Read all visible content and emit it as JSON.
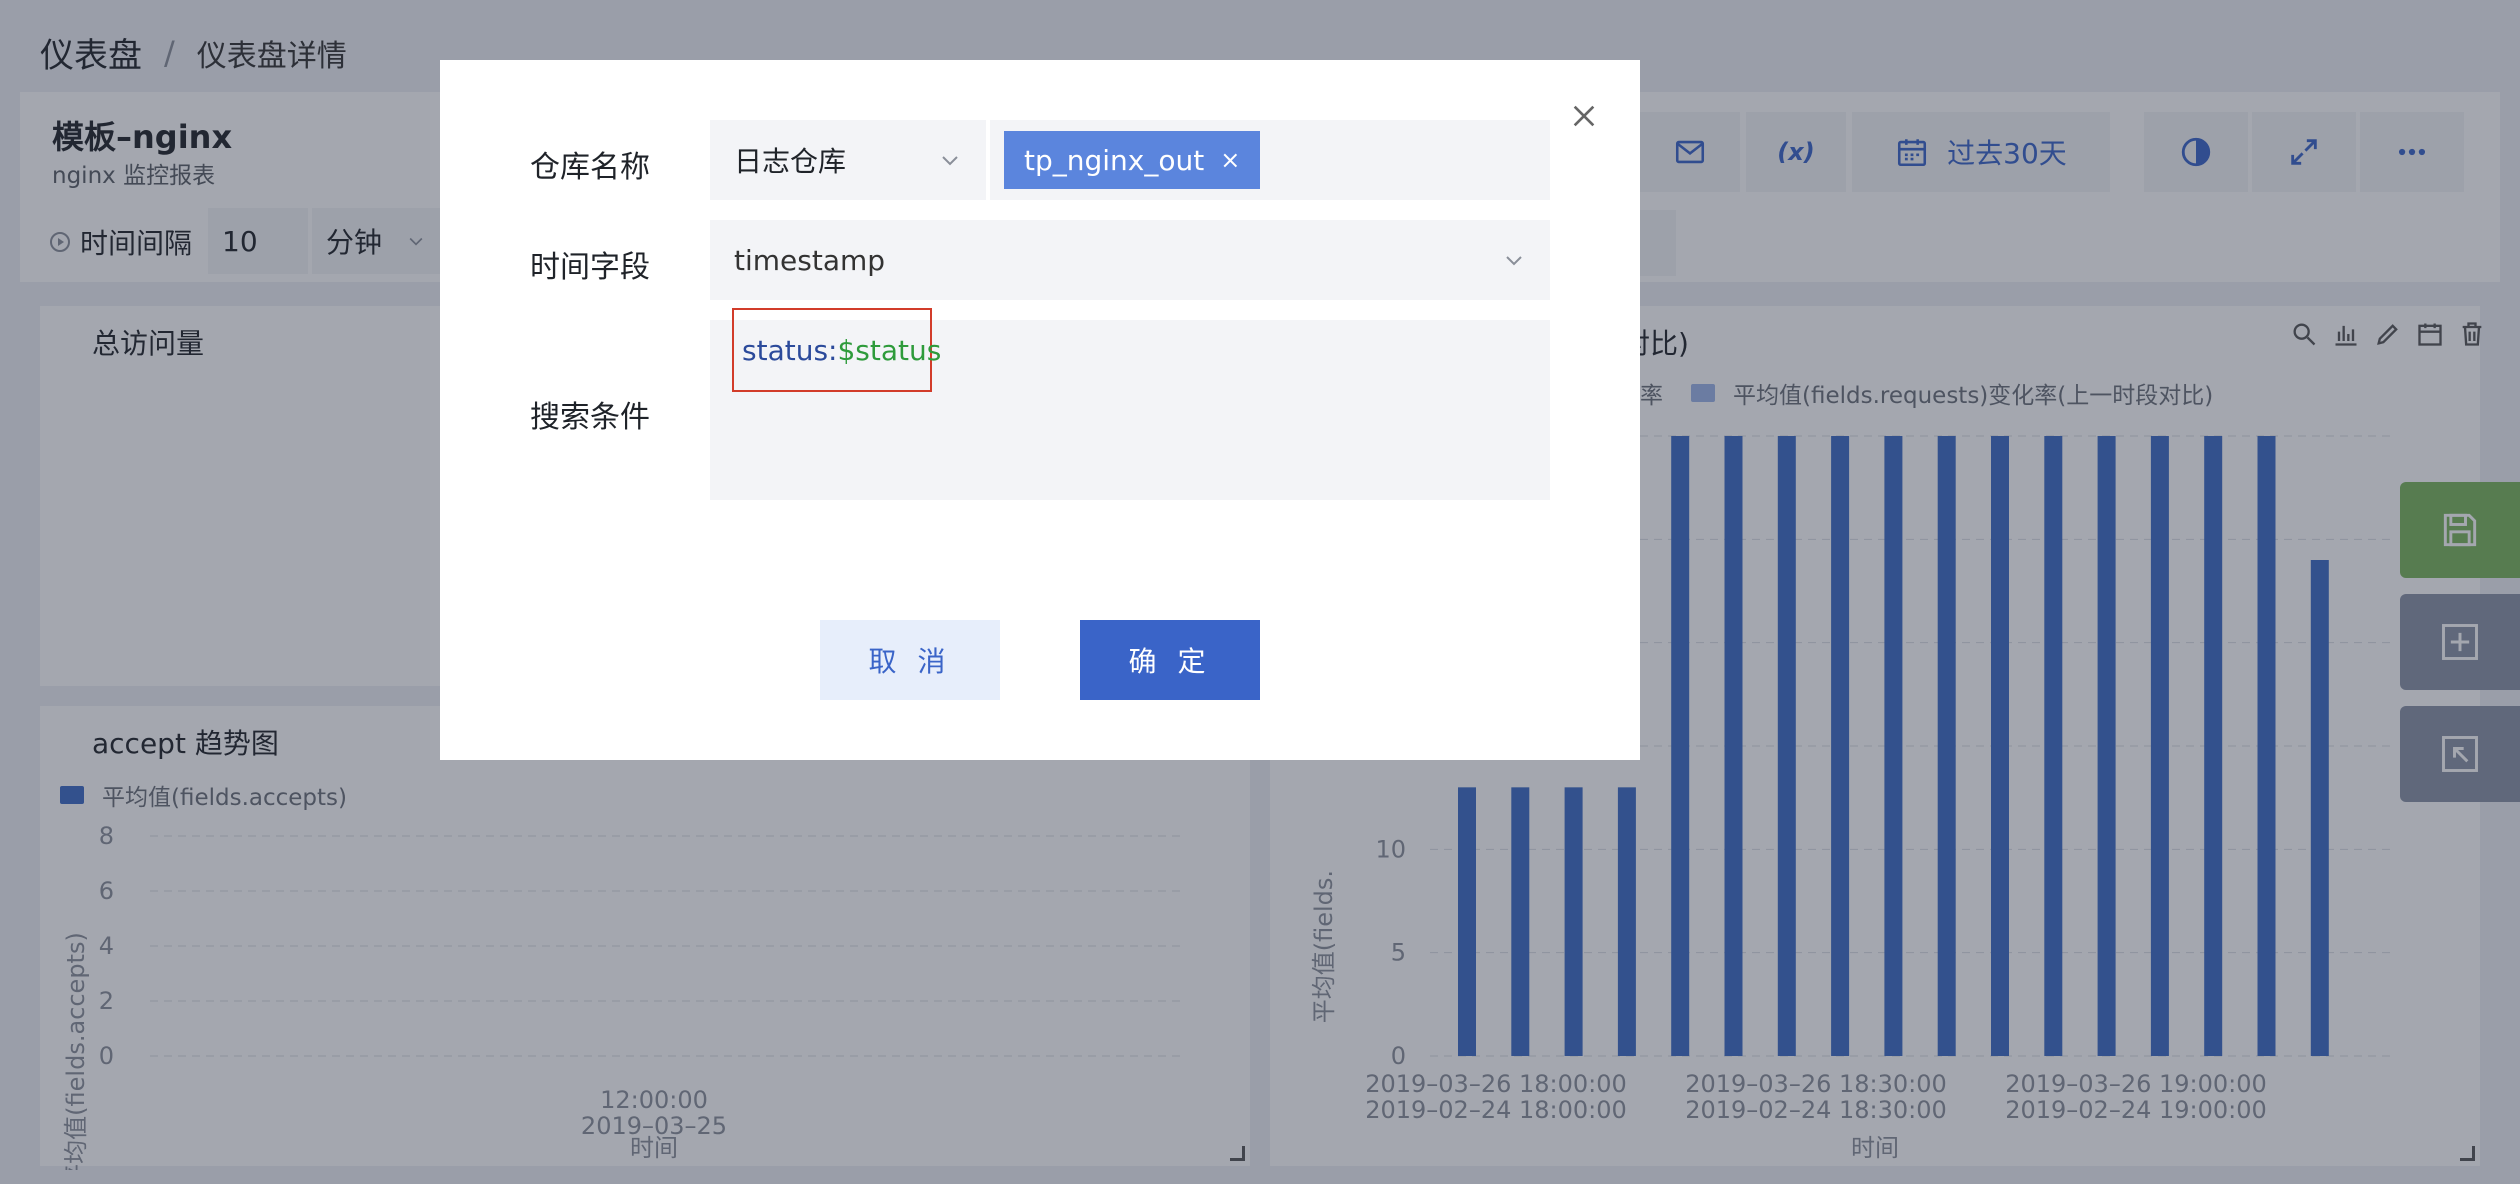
{
  "breadcrumb": {
    "root": "仪表盘",
    "separator": "/",
    "current": "仪表盘详情"
  },
  "dashboard": {
    "title": "模板–nginx",
    "subtitle": "nginx 监控报表",
    "time_range": "过去30天",
    "refresh": {
      "label": "时间间隔",
      "value": "10",
      "unit": "分钟"
    }
  },
  "panels": {
    "total_visits": {
      "title": "总访问量"
    },
    "right_chart": {
      "title_fragment": "段对比)"
    },
    "accept": {
      "title": "accept 趋势图"
    }
  },
  "chart_data": [
    {
      "type": "line",
      "title": "accept 趋势图",
      "series": [
        {
          "name": "平均值(fields.accepts)",
          "values": []
        }
      ],
      "ylabel": "平均值(fields.accepts)",
      "xlabel": "时间",
      "y_ticks": [
        "0",
        "2",
        "4",
        "6",
        "8"
      ],
      "x_ticks": [
        {
          "line1": "12:00:00",
          "line2": "2019–03–25"
        }
      ],
      "legend": "top-left",
      "grid": true
    },
    {
      "type": "bar",
      "title": "段对比)",
      "legend_items": [
        "率",
        "平均值(fields.requests)变化率(上一时段对比)"
      ],
      "ylabel": "平均值(fields.",
      "xlabel": "时间",
      "y_ticks": [
        "0",
        "5",
        "10"
      ],
      "x_ticks": [
        {
          "line1": "2019–03–26 18:00:00",
          "line2": "2019–02–24 18:00:00"
        },
        {
          "line1": "2019–03–26 18:30:00",
          "line2": "2019–02–24 18:30:00"
        },
        {
          "line1": "2019–03–26 19:00:00",
          "line2": "2019–02–24 19:00:00"
        }
      ],
      "ylim": [
        0,
        30
      ],
      "bar_color": "#3d6bc4",
      "values": [
        13,
        13,
        13,
        13,
        30,
        30,
        30,
        30,
        30,
        30,
        30,
        30,
        30,
        30,
        30,
        30,
        24
      ],
      "grid": true
    }
  ],
  "modal": {
    "repo_label": "仓库名称",
    "repo_select": "日志仓库",
    "repo_tag": "tp_nginx_out",
    "time_field_label": "时间字段",
    "time_field_value": "timestamp",
    "search_label": "搜索条件",
    "query_key": "status:",
    "query_var": "$status",
    "cancel": "取 消",
    "confirm": "确 定"
  },
  "icons": {
    "close": "close-icon",
    "chevron": "chevron-down-icon",
    "mail": "mail-icon",
    "variable": "variable-icon",
    "calendar": "calendar-icon",
    "theme": "contrast-icon",
    "fullscreen": "expand-icon",
    "more": "more-icon",
    "save": "save-icon",
    "add": "add-icon",
    "exit": "exit-icon"
  },
  "colors": {
    "accent": "#3a64c8",
    "tag": "#5b85dd",
    "save_green": "#7ab55c",
    "highlight_border": "#d23c2a",
    "query_key": "#2b4a9b",
    "query_var": "#2e9b3b"
  }
}
